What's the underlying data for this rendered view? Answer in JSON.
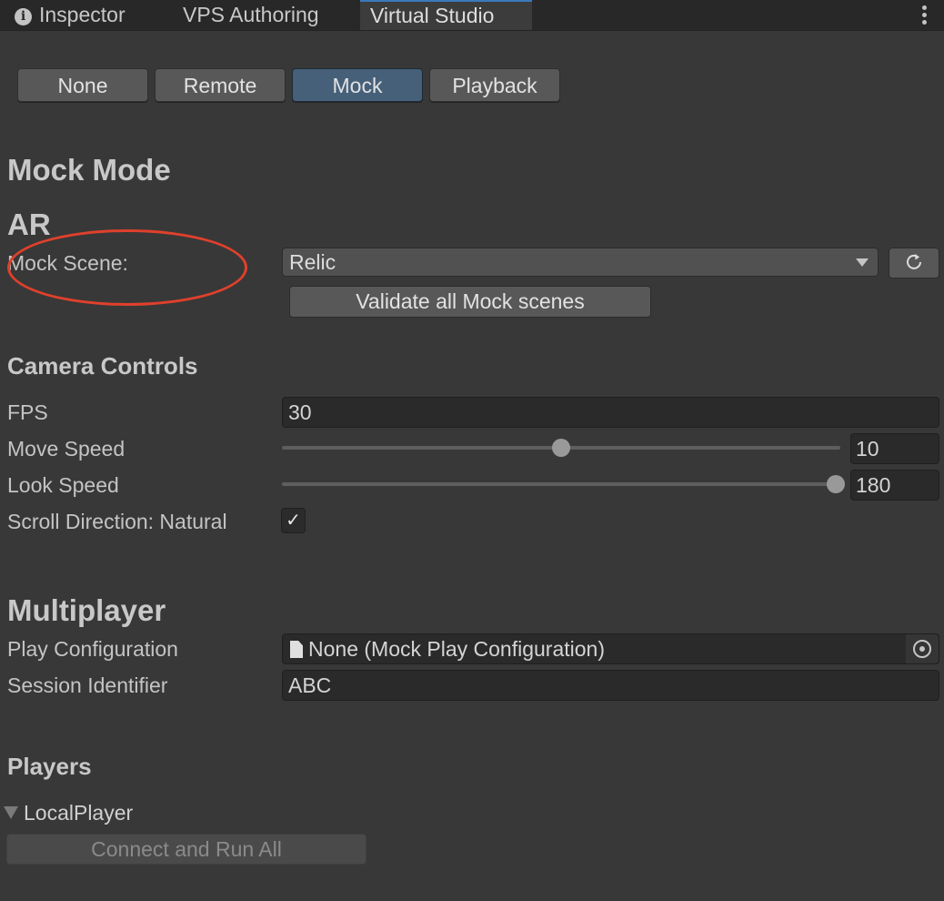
{
  "tabs": [
    {
      "label": "Inspector",
      "icon": "info-icon",
      "active": false
    },
    {
      "label": "VPS Authoring",
      "active": false
    },
    {
      "label": "Virtual Studio",
      "active": true
    }
  ],
  "tab_menu_icon": "kebab-menu-icon",
  "mode_buttons": [
    {
      "label": "None",
      "selected": false
    },
    {
      "label": "Remote",
      "selected": false
    },
    {
      "label": "Mock",
      "selected": true
    },
    {
      "label": "Playback",
      "selected": false
    }
  ],
  "mode_heading": "Mock Mode",
  "ar": {
    "heading": "AR",
    "mock_scene_label": "Mock Scene:",
    "mock_scene_value": "Relic",
    "refresh_icon": "refresh-icon",
    "validate_button": "Validate all Mock scenes"
  },
  "camera": {
    "heading": "Camera Controls",
    "fps_label": "FPS",
    "fps_value": "30",
    "move_speed_label": "Move Speed",
    "move_speed_value": "10",
    "move_speed_fraction": 0.5,
    "look_speed_label": "Look Speed",
    "look_speed_value": "180",
    "look_speed_fraction": 1.0,
    "scroll_label": "Scroll Direction: Natural",
    "scroll_checked": true,
    "check_glyph": "✓"
  },
  "multiplayer": {
    "heading": "Multiplayer",
    "play_config_label": "Play Configuration",
    "play_config_value": "None (Mock Play Configuration)",
    "session_label": "Session Identifier",
    "session_value": "ABC"
  },
  "players": {
    "heading": "Players",
    "local_player": "LocalPlayer",
    "connect_button": "Connect and Run All"
  },
  "annotation": {
    "color": "#e0402c",
    "shape": "ellipse",
    "target": "Mock Scene label"
  },
  "colors": {
    "selected_button": "#46607a",
    "tab_accent": "#3a79bb",
    "background": "#383838"
  }
}
